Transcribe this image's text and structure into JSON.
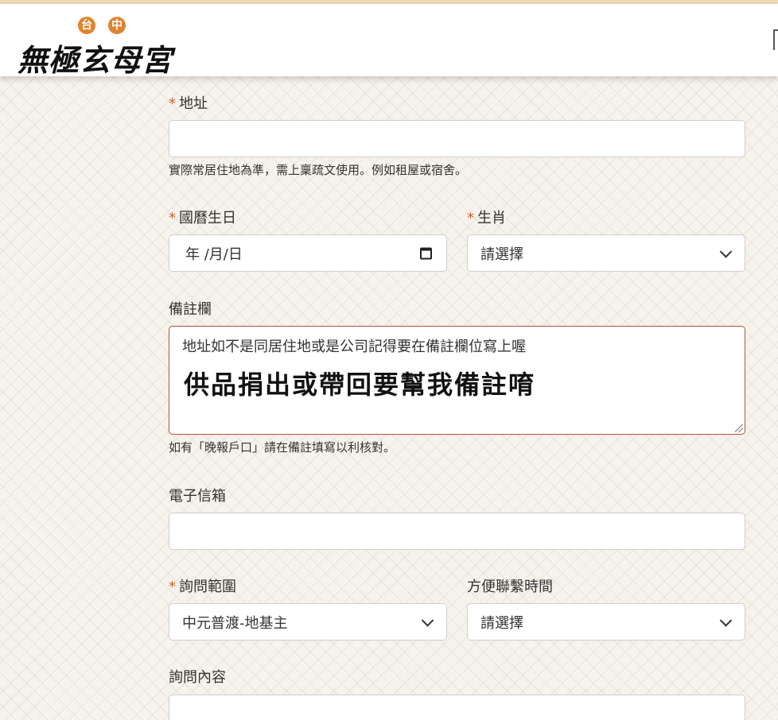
{
  "header": {
    "badges": [
      "台",
      "中"
    ],
    "logo_text": "無極玄母宮"
  },
  "form": {
    "address": {
      "label": "地址",
      "required_mark": "*",
      "value": "",
      "help": "實際常居住地為準，需上稟疏文使用。例如租屋或宿舍。"
    },
    "birthday": {
      "label": "國曆生日",
      "required_mark": "*",
      "placeholder": "年 /月/日"
    },
    "zodiac": {
      "label": "生肖",
      "required_mark": "*",
      "selected": "請選擇"
    },
    "remarks": {
      "label": "備註欄",
      "line1": "地址如不是同居住地或是公司記得要在備註欄位寫上喔",
      "line2": "供品捐出或帶回要幫我備註唷",
      "help": "如有「晚報戶口」請在備註填寫以利核對。"
    },
    "email": {
      "label": "電子信箱",
      "value": ""
    },
    "inquiry_scope": {
      "label": "詢問範圍",
      "required_mark": "*",
      "selected": "中元普渡-地基主"
    },
    "contact_time": {
      "label": "方便聯繫時間",
      "selected": "請選擇"
    },
    "inquiry_content": {
      "label": "詢問內容",
      "value": ""
    }
  },
  "colors": {
    "required": "#e05a2b",
    "logo_badge": "#e0832c",
    "textarea_border": "#b5523a"
  }
}
